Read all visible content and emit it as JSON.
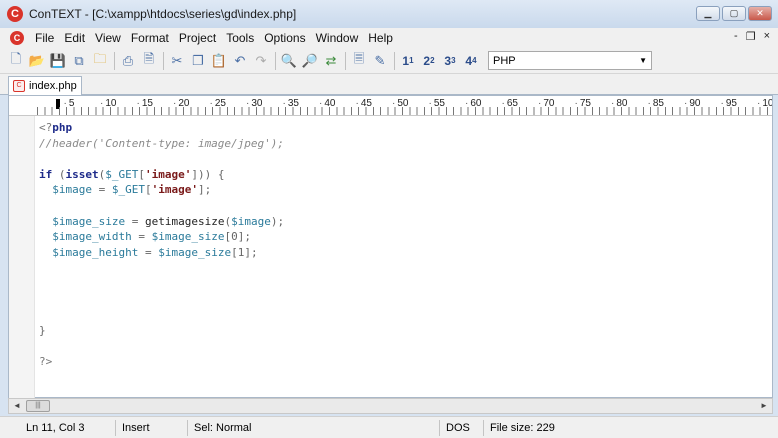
{
  "window": {
    "app_icon": "C",
    "title": "ConTEXT - [C:\\xampp\\htdocs\\series\\gd\\index.php]",
    "buttons": {
      "minimize": "▁",
      "maximize": "▢",
      "close": "✕"
    }
  },
  "menu": {
    "logo": "C",
    "items": [
      "File",
      "Edit",
      "View",
      "Format",
      "Project",
      "Tools",
      "Options",
      "Window",
      "Help"
    ],
    "mdi_buttons": [
      "-",
      "❐",
      "×"
    ]
  },
  "toolbar": {
    "icons": [
      "new-file-icon",
      "open-folder-icon",
      "save-icon",
      "save-all-icon",
      "close-file-icon",
      "print-icon",
      "print-preview-icon",
      "cut-icon",
      "copy-icon",
      "paste-icon",
      "undo-icon",
      "redo-icon",
      "find-icon",
      "find-next-icon",
      "replace-icon",
      "document-icon",
      "tools-icon"
    ],
    "user_commands": [
      {
        "label": "1",
        "sub": "1"
      },
      {
        "label": "2",
        "sub": "2"
      },
      {
        "label": "3",
        "sub": "3"
      },
      {
        "label": "4",
        "sub": "4"
      }
    ],
    "highlighter_value": "PHP"
  },
  "tabs": [
    {
      "label": "index.php",
      "icon": "php-file-icon"
    }
  ],
  "ruler": {
    "numbers": [
      "5",
      "10",
      "15",
      "20",
      "25",
      "30",
      "35",
      "40",
      "45",
      "50",
      "55",
      "60",
      "65",
      "70",
      "75",
      "80",
      "85",
      "90",
      "95",
      "10"
    ]
  },
  "code_lines": [
    [
      {
        "t": "<?",
        "c": "tag"
      },
      {
        "t": "php",
        "c": "key"
      }
    ],
    [
      {
        "t": "//header('Content-type: image/jpeg');",
        "c": "comment"
      }
    ],
    [],
    [
      {
        "t": "if",
        "c": "key"
      },
      {
        "t": " (",
        "c": "punc"
      },
      {
        "t": "isset",
        "c": "key"
      },
      {
        "t": "(",
        "c": "punc"
      },
      {
        "t": "$_GET",
        "c": "var"
      },
      {
        "t": "[",
        "c": "punc"
      },
      {
        "t": "'image'",
        "c": "str"
      },
      {
        "t": "])) {",
        "c": "punc"
      }
    ],
    [
      {
        "t": "  $image",
        "c": "var"
      },
      {
        "t": " = ",
        "c": "punc"
      },
      {
        "t": "$_GET",
        "c": "var"
      },
      {
        "t": "[",
        "c": "punc"
      },
      {
        "t": "'image'",
        "c": "str"
      },
      {
        "t": "];",
        "c": "punc"
      }
    ],
    [],
    [
      {
        "t": "  $image_size",
        "c": "var"
      },
      {
        "t": " = ",
        "c": "punc"
      },
      {
        "t": "getimagesize",
        "c": "func"
      },
      {
        "t": "(",
        "c": "punc"
      },
      {
        "t": "$image",
        "c": "var"
      },
      {
        "t": ");",
        "c": "punc"
      }
    ],
    [
      {
        "t": "  $image_width",
        "c": "var"
      },
      {
        "t": " = ",
        "c": "punc"
      },
      {
        "t": "$image_size",
        "c": "var"
      },
      {
        "t": "[0];",
        "c": "punc"
      }
    ],
    [
      {
        "t": "  $image_height",
        "c": "var"
      },
      {
        "t": " = ",
        "c": "punc"
      },
      {
        "t": "$image_size",
        "c": "var"
      },
      {
        "t": "[1];",
        "c": "punc"
      }
    ],
    [],
    [],
    [],
    [],
    [
      {
        "t": "}",
        "c": "punc"
      }
    ],
    [],
    [
      {
        "t": "?>",
        "c": "tag"
      }
    ]
  ],
  "scrollbar": {
    "left": "◄",
    "right": "►",
    "thumb": "|||"
  },
  "status": {
    "position": "Ln 11, Col 3",
    "mode": "Insert",
    "selection": "Sel: Normal",
    "line_ending": "DOS",
    "file_size": "File size: 229"
  }
}
